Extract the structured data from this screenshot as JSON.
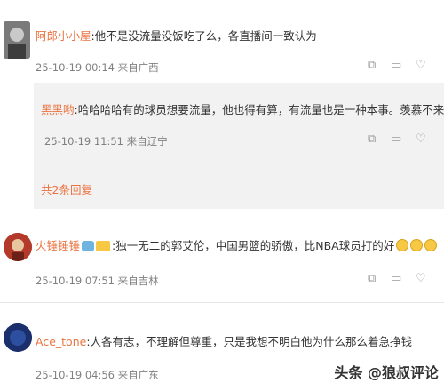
{
  "comments": [
    {
      "username": "阿郎小小屋",
      "text": ":他不是没流量没饭吃了么，各直播间一致认为",
      "date": "25-10-19 00:14",
      "location": "来自广西"
    },
    {
      "username": "Ace_tone",
      "text": ":人各有志，不理解但尊重，只是我想不明白他为什么那么着急挣钱",
      "date": "25-10-19 04:56",
      "location": "来自广东"
    },
    {
      "username": "火锤锤锤",
      "text": ":独一无二的郭艾伦，中国男篮的骄傲，比NBA球员打的好",
      "date": "25-10-19 07:51",
      "location": "来自吉林"
    }
  ],
  "reply": {
    "username": "黑黑哟",
    "text": ":哈哈哈哈有的球员想要流量，他也得有算，有流量也是一种本事。羡慕不来",
    "date": "25-10-19 11:51",
    "location": "来自辽宁"
  },
  "reply_count": "共2条回复",
  "watermark": "头条 @狼叔评论",
  "colors": {
    "username": "#eb7340",
    "meta": "#808080",
    "reply_bg": "#f2f2f2"
  },
  "icons": [
    "share-icon",
    "comment-icon",
    "like-icon"
  ]
}
